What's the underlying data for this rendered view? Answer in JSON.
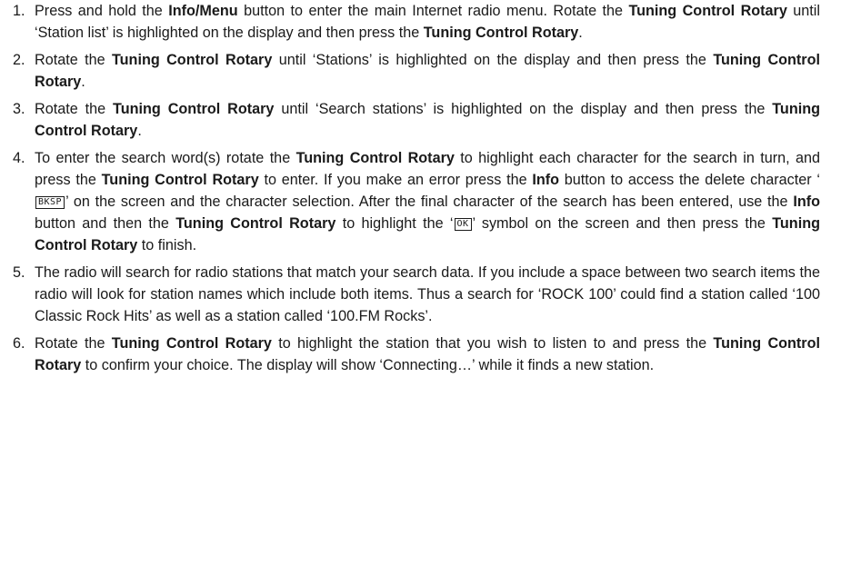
{
  "steps": [
    {
      "number": "1.",
      "parts": [
        {
          "t": "Press and hold the "
        },
        {
          "b": "Info/Menu"
        },
        {
          "t": " button to enter the main Internet radio menu. Rotate the "
        },
        {
          "b": "Tuning Control Rotary"
        },
        {
          "t": " until ‘Station list’ is highlighted on the display and then press the "
        },
        {
          "b": "Tuning Control Rotary"
        },
        {
          "t": "."
        }
      ]
    },
    {
      "number": "2.",
      "parts": [
        {
          "t": "Rotate the "
        },
        {
          "b": "Tuning Control Rotary"
        },
        {
          "t": " until ‘Stations’ is highlighted on the display and then press the "
        },
        {
          "b": "Tuning Control Rotary"
        },
        {
          "t": "."
        }
      ]
    },
    {
      "number": "3.",
      "parts": [
        {
          "t": "Rotate the "
        },
        {
          "b": "Tuning Control Rotary"
        },
        {
          "t": " until ‘Search stations’ is highlighted on the display and then press the "
        },
        {
          "b": "Tuning Control Rotary"
        },
        {
          "t": "."
        }
      ]
    },
    {
      "number": "4.",
      "parts": [
        {
          "t": "To enter the search word(s) rotate the "
        },
        {
          "b": "Tuning Control Rotary"
        },
        {
          "t": " to highlight each character for the search in turn, and press the "
        },
        {
          "b": "Tuning Control Rotary"
        },
        {
          "t": " to enter. If you make an error press the "
        },
        {
          "b": "Info"
        },
        {
          "t": " button to access the delete character ‘"
        },
        {
          "lcd": "BKSP"
        },
        {
          "t": "’ on the screen and the character selection. After the final character of the search has been entered, use the "
        },
        {
          "b": "Info"
        },
        {
          "t": " button and then the "
        },
        {
          "b": "Tuning Control Rotary"
        },
        {
          "t": " to highlight the ‘"
        },
        {
          "lcd": "OK"
        },
        {
          "t": "’ symbol on the screen and then press the "
        },
        {
          "b": "Tuning Control Rotary"
        },
        {
          "t": " to finish."
        }
      ]
    },
    {
      "number": "5.",
      "parts": [
        {
          "t": "The radio will search for radio stations that match your search data. If you include a space between two search items the radio will look for station names which include both items. Thus a search for ‘ROCK 100’ could find a station called ‘100 Classic Rock Hits’ as well as a station called ‘100.FM Rocks’."
        }
      ]
    },
    {
      "number": "6.",
      "parts": [
        {
          "t": "Rotate the "
        },
        {
          "b": "Tuning Control Rotary"
        },
        {
          "t": " to highlight the station that you wish to listen to and press the "
        },
        {
          "b": "Tuning Control Rotary"
        },
        {
          "t": " to confirm your choice. The display will show ‘Connecting…’ while it finds a new station."
        }
      ]
    }
  ]
}
